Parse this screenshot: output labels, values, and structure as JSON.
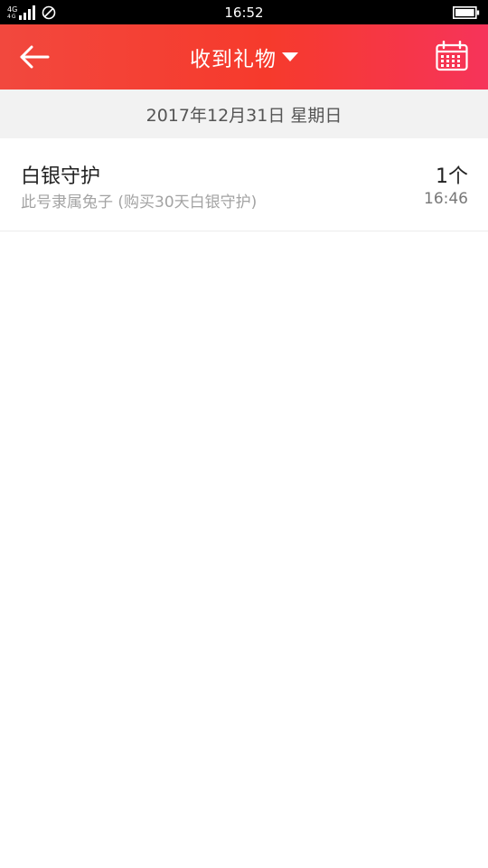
{
  "status_bar": {
    "network_top": "4G",
    "network_top2": "4G",
    "time": "16:52",
    "icons": [
      "signal-icon",
      "no-sim-icon",
      "battery-icon"
    ]
  },
  "app_bar": {
    "title": "收到礼物",
    "back_icon": "back-arrow-icon",
    "dropdown_icon": "triangle-down-icon",
    "calendar_icon": "calendar-icon",
    "colors": {
      "start": "#f2483e",
      "mid": "#f63a2c",
      "end": "#f6345a"
    }
  },
  "date_header": {
    "text": "2017年12月31日 星期日"
  },
  "gifts": [
    {
      "name": "白银守护",
      "description": "此号隶属兔子 (购买30天白银守护)",
      "count": "1个",
      "time": "16:46"
    }
  ]
}
